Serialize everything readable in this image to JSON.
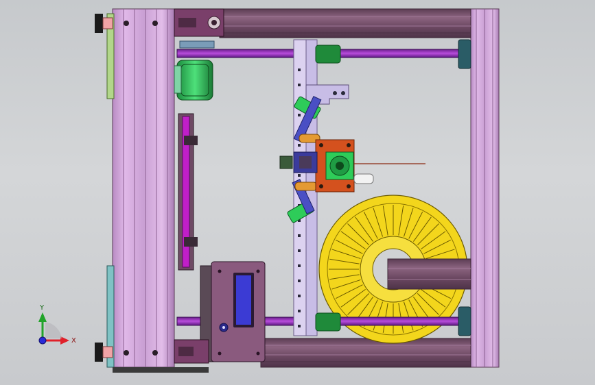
{
  "view": {
    "background_color": "#d0d2d4"
  },
  "triad": {
    "x_label": "X",
    "y_label": "Y",
    "x_color": "#e0202a",
    "y_color": "#22a32a",
    "origin_color": "#2a2ad8"
  },
  "colors": {
    "frame_profile": "#d7a6df",
    "frame_dark": "#6e4a64",
    "rod": "#9a2fc2",
    "rod_collar": "#1f8a3a",
    "motor": "#2ecc59",
    "carriage": "#d4511e",
    "linkage": "#e49a33",
    "spool": "#f3d61c",
    "guide_rail": "#d9c8ee",
    "control_box": "#8a5a7e",
    "display": "#3b3bd4",
    "magenta_slot": "#c01fc8",
    "wire": "#8b2b12"
  }
}
